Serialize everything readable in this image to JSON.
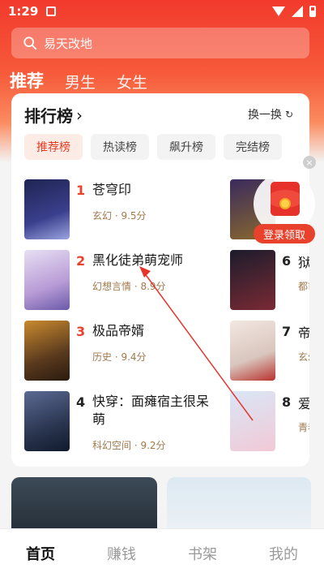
{
  "status": {
    "time": "1:29"
  },
  "search": {
    "placeholder": "易天改地"
  },
  "channels": [
    "推荐",
    "男生",
    "女生"
  ],
  "ranking": {
    "title": "排行榜",
    "refresh_label": "换一换",
    "tabs": [
      "推荐榜",
      "热读榜",
      "飙升榜",
      "完结榜"
    ],
    "left": [
      {
        "rank": "1",
        "title": "苍穹印",
        "meta": "玄幻 · 9.5分",
        "cover": [
          "#1f2452",
          "#3a3f8c"
        ]
      },
      {
        "rank": "2",
        "title": "黑化徒弟萌宠师",
        "meta": "幻想言情 · 8.9分",
        "cover": [
          "#b89bd6",
          "#e7dff3"
        ]
      },
      {
        "rank": "3",
        "title": "极品帝婿",
        "meta": "历史 · 9.4分",
        "cover": [
          "#5a3a1e",
          "#c98a2e"
        ]
      },
      {
        "rank": "4",
        "title": "快穿：面瘫宿主很呆萌",
        "meta": "科幻空间 · 9.2分",
        "cover": [
          "#2a3550",
          "#5b6a93"
        ]
      }
    ],
    "right": [
      {
        "rank": "",
        "title": "",
        "meta": "",
        "cover": [
          "#3a2a5e",
          "#8a6a2c"
        ]
      },
      {
        "rank": "6",
        "title": "狱",
        "meta": "都市",
        "cover": [
          "#1c1c2c",
          "#7a2a34"
        ]
      },
      {
        "rank": "7",
        "title": "帝",
        "meta": "玄幻",
        "cover": [
          "#f2e7e2",
          "#b8322e"
        ]
      },
      {
        "rank": "8",
        "title": "爱",
        "meta": "青春",
        "cover": [
          "#d9e6f6",
          "#f2c9d6"
        ]
      }
    ]
  },
  "red_packet": {
    "label": "登录领取"
  },
  "bottom_nav": [
    "首页",
    "赚钱",
    "书架",
    "我的"
  ]
}
